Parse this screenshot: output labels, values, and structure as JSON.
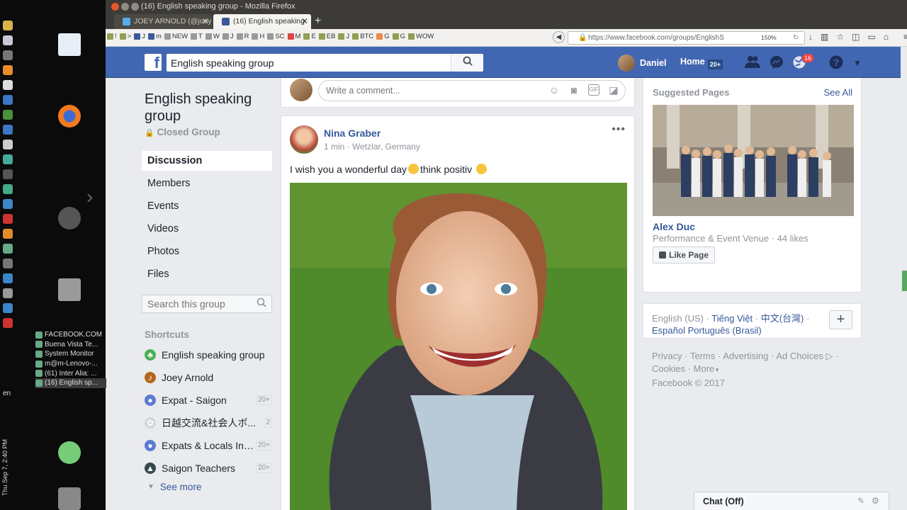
{
  "os": {
    "language": "en",
    "clock": "Thu Sep 7, 2:40 PM",
    "window_list": [
      "FACEBOOK.COM",
      "Buena Vista Te...",
      "System Monitor",
      "m@m-Lenovo-...",
      "(61) Inter Alia: ...",
      "(16) English sp..."
    ]
  },
  "browser": {
    "window_title": "(16) English speaking group - Mozilla Firefox",
    "tabs": [
      {
        "label": "JOEY ARNOLD (@joey",
        "active": false
      },
      {
        "label": "(16) English speaking",
        "active": true
      }
    ],
    "url": "https://www.facebook.com/groups/EnglishS",
    "zoom": "150%",
    "bookmarks": [
      "!",
      ">",
      "J",
      "m",
      "NEW",
      "T",
      "W",
      "J",
      "R",
      "H",
      "SC",
      "M",
      "E",
      "EB",
      "J",
      "BTC",
      "G",
      "G",
      "WOW"
    ]
  },
  "fb_header": {
    "search_value": "English speaking group",
    "user_name": "Daniel",
    "home_label": "Home",
    "home_count": "20+",
    "notification_count": "16"
  },
  "group": {
    "name": "English speaking group",
    "type": "Closed Group",
    "nav": [
      "Discussion",
      "Members",
      "Events",
      "Videos",
      "Photos",
      "Files"
    ],
    "search_placeholder": "Search this group",
    "shortcuts_label": "Shortcuts",
    "shortcuts": [
      {
        "name": "English speaking group",
        "badge": "",
        "color": "#4caf50"
      },
      {
        "name": "Joey Arnold",
        "badge": "",
        "color": "#b5651d"
      },
      {
        "name": "Expat - Saigon",
        "badge": "20+",
        "color": "#5b7bd5"
      },
      {
        "name": "日越交流&社会人ボ...",
        "badge": "2",
        "color": "#cfd8dc"
      },
      {
        "name": "Expats & Locals In ...",
        "badge": "20+",
        "color": "#5b7bd5"
      },
      {
        "name": "Saigon Teachers",
        "badge": "20+",
        "color": "#37474f"
      }
    ],
    "see_more": "See more"
  },
  "comment_box": {
    "placeholder": "Write a comment..."
  },
  "post": {
    "author": "Nina Graber",
    "time": "1 min",
    "location": "Wetzlar, Germany",
    "text_part1": "I wish you a wonderful day",
    "text_part2": "think positiv"
  },
  "suggested_pages": {
    "title": "Suggested Pages",
    "see_all": "See All",
    "page_name": "Alex Duc",
    "page_desc": "Performance & Event Venue · 44 likes",
    "like_button": "Like Page"
  },
  "languages": {
    "current": "English (US)",
    "others": [
      "Tiếng Việt",
      "中文(台灣)",
      "Español",
      "Português (Brasil)"
    ]
  },
  "footer": {
    "links": [
      "Privacy",
      "Terms",
      "Advertising",
      "Ad Choices",
      "Cookies",
      "More"
    ],
    "copyright": "Facebook © 2017"
  },
  "chat": {
    "label": "Chat (Off)"
  },
  "colors": {
    "fb_blue": "#4267b2",
    "link_blue": "#365899",
    "badge_red": "#fa3e3e",
    "page_bg": "#e9ebee"
  }
}
